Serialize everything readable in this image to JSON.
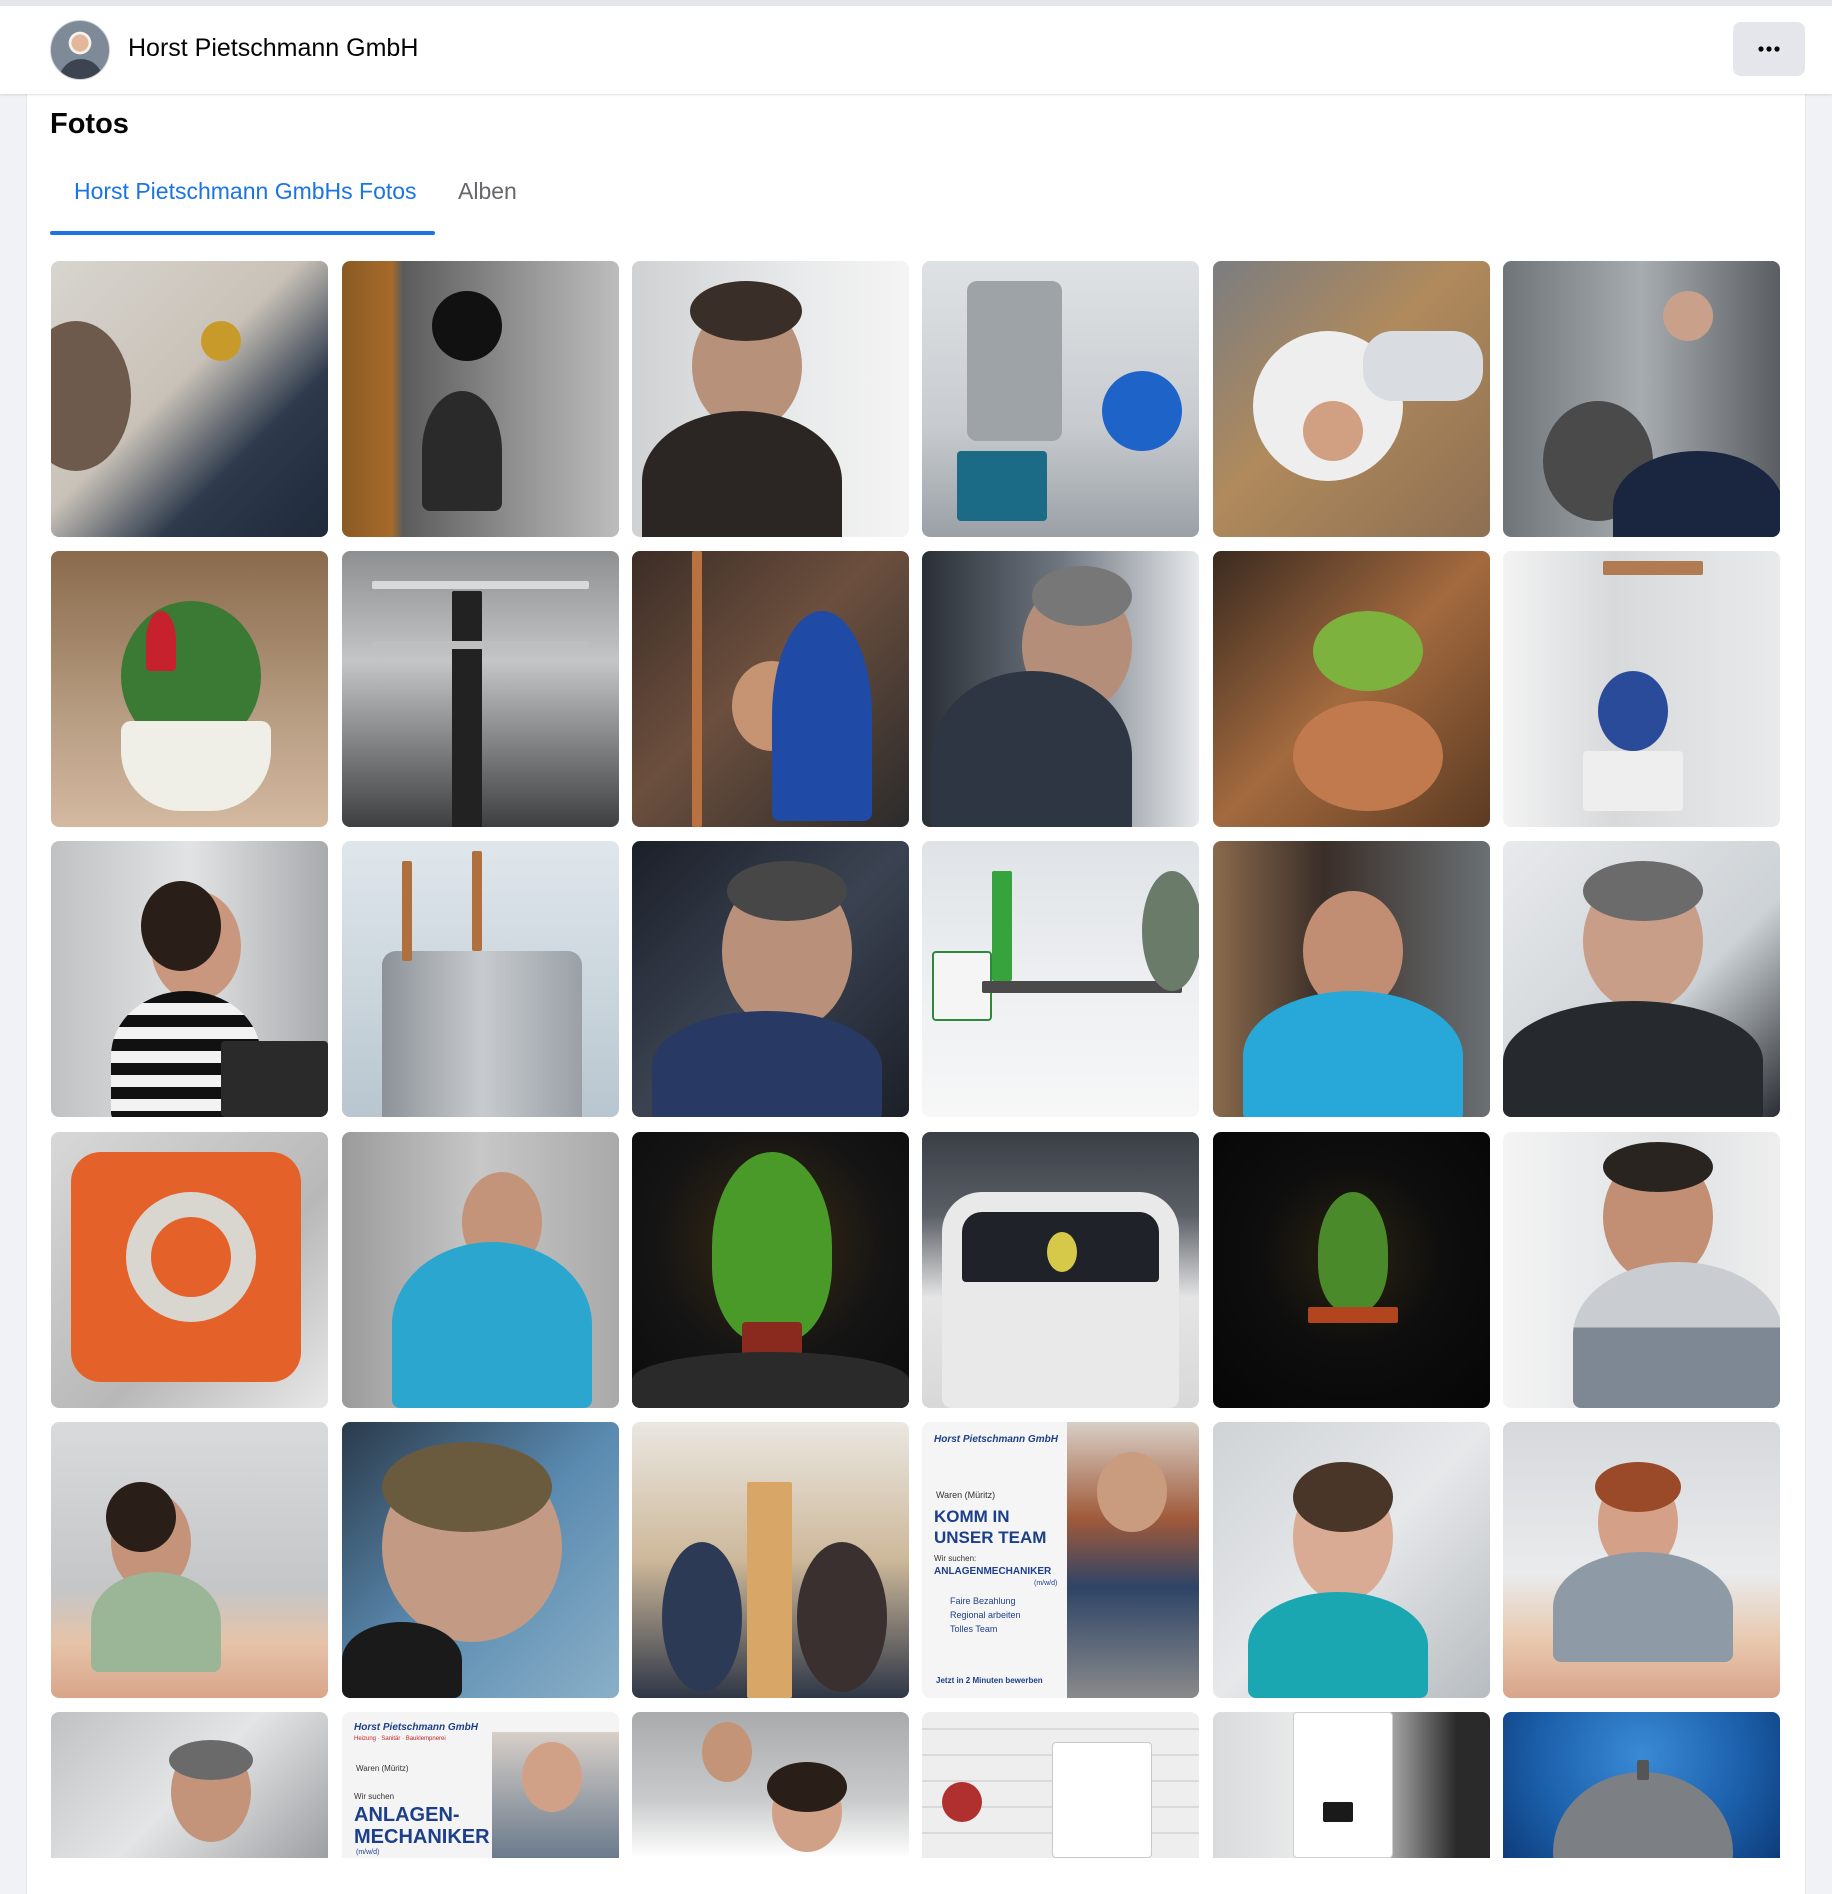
{
  "header": {
    "page_name": "Horst Pietschmann GmbH",
    "more_label": "⋯"
  },
  "section": {
    "title": "Fotos"
  },
  "tabs": [
    {
      "label": "Horst Pietschmann GmbHs Fotos",
      "active": true
    },
    {
      "label": "Alben",
      "active": false
    }
  ],
  "posters": {
    "recruit": {
      "brand": "Horst Pietschmann GmbH",
      "location": "Waren (Müritz)",
      "headline_1": "KOMM IN",
      "headline_2": "UNSER TEAM",
      "we_seek": "Wir suchen:",
      "job": "ANLAGENMECHANIKER",
      "gender": "(m/w/d)",
      "bullet_1": "Faire Bezahlung",
      "bullet_2": "Regional arbeiten",
      "bullet_3": "Tolles Team",
      "cta": "Jetzt in 2 Minuten bewerben"
    },
    "recruit2": {
      "brand": "Horst Pietschmann GmbH",
      "tagline": "Heizung · Sanitär · Bauklempnerei",
      "location": "Waren (Müritz)",
      "we_seek": "Wir suchen",
      "job_1": "ANLAGEN-",
      "job_2": "MECHANIKER",
      "gender": "(m/w/d)"
    }
  },
  "colors": {
    "accent": "#1b74e4",
    "muted_text": "#65676b",
    "button_bg": "#e4e6eb"
  }
}
